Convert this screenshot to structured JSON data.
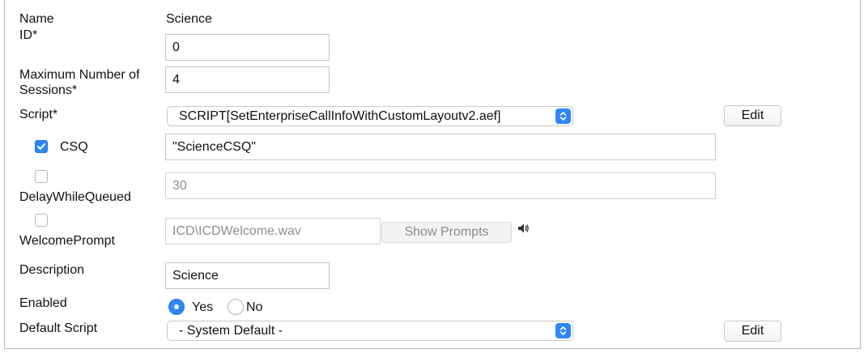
{
  "form": {
    "name": {
      "label": "Name",
      "value": "Science"
    },
    "id": {
      "label": "ID*",
      "value": "0"
    },
    "max_sessions": {
      "label_line1": "Maximum Number of",
      "label_line2": "Sessions*",
      "value": "4"
    },
    "script": {
      "label": "Script*",
      "selected": "SCRIPT[SetEnterpriseCallInfoWithCustomLayoutv2.aef]",
      "edit_label": "Edit"
    },
    "csq": {
      "label": "CSQ",
      "checked": true,
      "value": "\"ScienceCSQ\""
    },
    "delay_while_queued": {
      "label": "DelayWhileQueued",
      "checked": false,
      "value": "30"
    },
    "welcome_prompt": {
      "label": "WelcomePrompt",
      "checked": false,
      "value": "ICD\\ICDWelcome.wav",
      "show_prompts_label": "Show Prompts",
      "icon": "speaker-icon"
    },
    "description": {
      "label": "Description",
      "value": "Science"
    },
    "enabled": {
      "label": "Enabled",
      "options": [
        {
          "label": "Yes",
          "selected": true
        },
        {
          "label": "No",
          "selected": false
        }
      ]
    },
    "default_script": {
      "label": "Default Script",
      "selected": "- System Default -",
      "edit_label": "Edit"
    }
  },
  "colors": {
    "accent": "#2f86f6",
    "border": "#c6c6c6",
    "disabled_text": "#8e8e8e"
  }
}
